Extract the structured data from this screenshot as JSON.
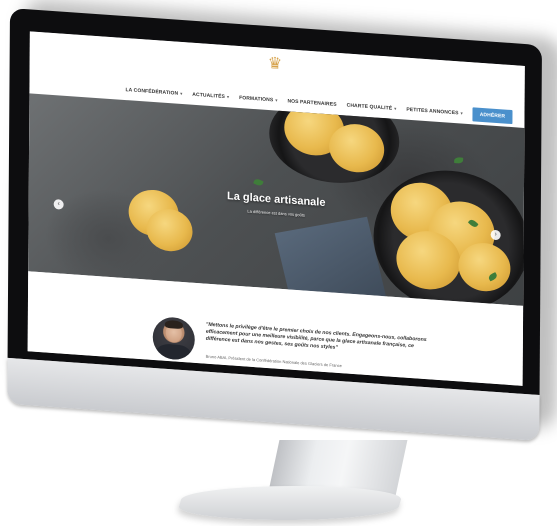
{
  "site": {
    "logo_icon": "cone-logo-icon",
    "nav": {
      "items": [
        {
          "label": "LA CONFÉDÉRATION",
          "has_dropdown": true
        },
        {
          "label": "ACTUALITÉS",
          "has_dropdown": true
        },
        {
          "label": "FORMATIONS",
          "has_dropdown": true
        },
        {
          "label": "NOS PARTENAIRES",
          "has_dropdown": false
        },
        {
          "label": "CHARTE QUALITÉ",
          "has_dropdown": true
        },
        {
          "label": "PETITES ANNONCES",
          "has_dropdown": true
        }
      ],
      "cta_label": "ADHÉRER",
      "cta_color": "#4a90cc"
    },
    "hero": {
      "title": "La glace artisanale",
      "subtitle": "La différence est dans vos goûts",
      "prev_icon": "chevron-left-icon",
      "next_icon": "chevron-right-icon"
    },
    "quote": {
      "text": "\"Mettons le privilège d'être le premier choix de nos clients. Engageons-nous, collaborons efficacement pour une meilleure visibilité, parce que la glace artisanale française, ce différence est dans nos gestes, ses goûts nos styles\"",
      "author": "Bruno ABAL Président de la Confédération Nationale des Glaciers de France"
    }
  },
  "chevrons": {
    "down": "▾",
    "left": "‹",
    "right": "›"
  }
}
